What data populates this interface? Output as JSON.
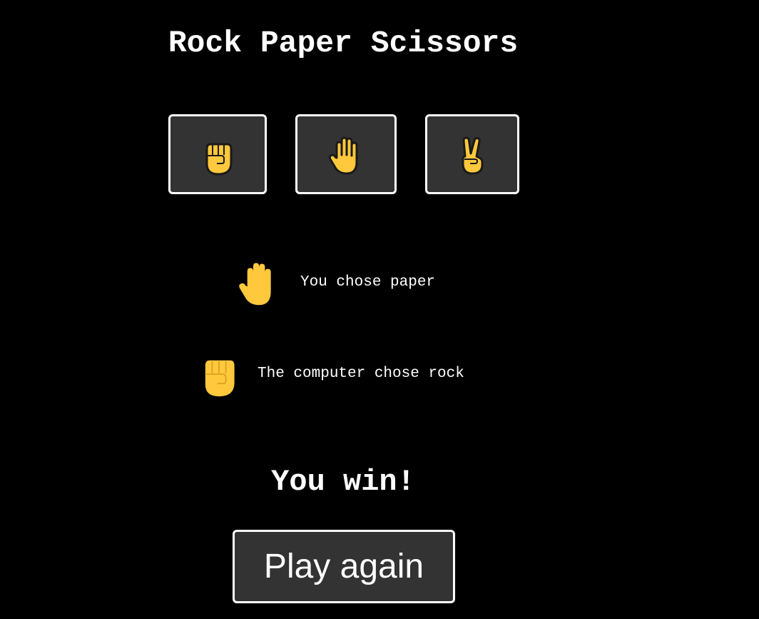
{
  "title": "Rock Paper Scissors",
  "choices": [
    {
      "id": "rock",
      "icon": "raised-fist-icon"
    },
    {
      "id": "paper",
      "icon": "raised-hand-icon"
    },
    {
      "id": "scissors",
      "icon": "victory-hand-icon"
    }
  ],
  "player": {
    "icon": "raised-hand-icon",
    "text": "You chose paper"
  },
  "computer": {
    "icon": "raised-fist-icon",
    "text": "The computer chose rock"
  },
  "outcome": "You win!",
  "play_again_label": "Play again",
  "colors": {
    "background": "#000000",
    "button_bg": "#333333",
    "button_border": "#ffffff",
    "emoji_fill": "#FFC83D",
    "emoji_stroke": "#1a1a1a"
  }
}
